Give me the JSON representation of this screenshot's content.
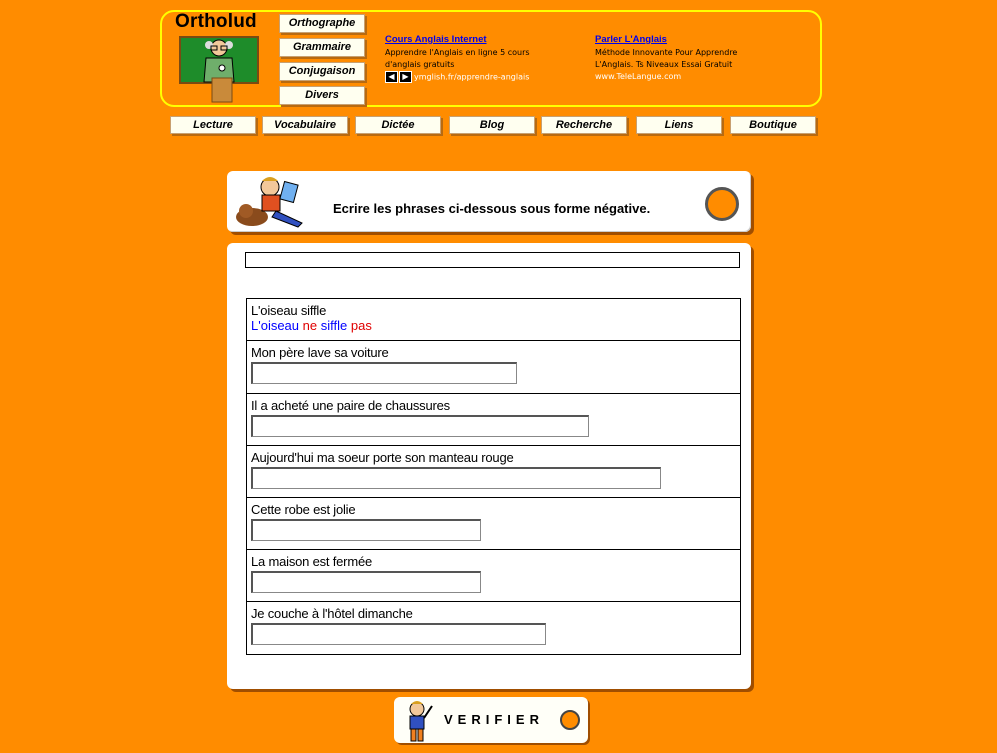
{
  "header": {
    "logo_title": "Ortholud",
    "categories": [
      "Orthographe",
      "Grammaire",
      "Conjugaison",
      "Divers"
    ],
    "ads": [
      {
        "title": "Cours Anglais Internet",
        "line1": "Apprendre l'Anglais en ligne 5 cours",
        "line2": "d'anglais gratuits",
        "url": "ymglish.fr/apprendre-anglais"
      },
      {
        "title": "Parler L'Anglais",
        "line1": "Méthode Innovante Pour Apprendre",
        "line2": "L'Anglais. Ts Niveaux Essai Gratuit",
        "url": "www.TeleLangue.com"
      }
    ]
  },
  "nav": [
    "Lecture",
    "Vocabulaire",
    "Dictée",
    "Blog",
    "Recherche",
    "Liens",
    "Boutique"
  ],
  "instruction": "Ecrire les phrases ci-dessous sous forme négative.",
  "example": {
    "sentence": "L'oiseau siffle",
    "answer_parts": [
      {
        "text": "L'oiseau",
        "color": "blue"
      },
      {
        "text": "ne",
        "color": "red"
      },
      {
        "text": "siffle",
        "color": "blue"
      },
      {
        "text": "pas",
        "color": "red"
      }
    ]
  },
  "exercises": [
    {
      "sentence": "Mon père lave sa voiture",
      "value": ""
    },
    {
      "sentence": "Il a acheté une paire de chaussures",
      "value": ""
    },
    {
      "sentence": "Aujourd'hui ma soeur porte son manteau rouge",
      "value": ""
    },
    {
      "sentence": "Cette robe est jolie",
      "value": ""
    },
    {
      "sentence": "La maison est fermée",
      "value": ""
    },
    {
      "sentence": "Je couche à l'hôtel dimanche",
      "value": ""
    }
  ],
  "verify_label": "VERIFIER",
  "colors": {
    "page_bg": "#FF8C00",
    "header_border": "#FFFF00",
    "link": "#0000EE",
    "example_blue": "#0000FF",
    "example_red": "#E00000"
  }
}
